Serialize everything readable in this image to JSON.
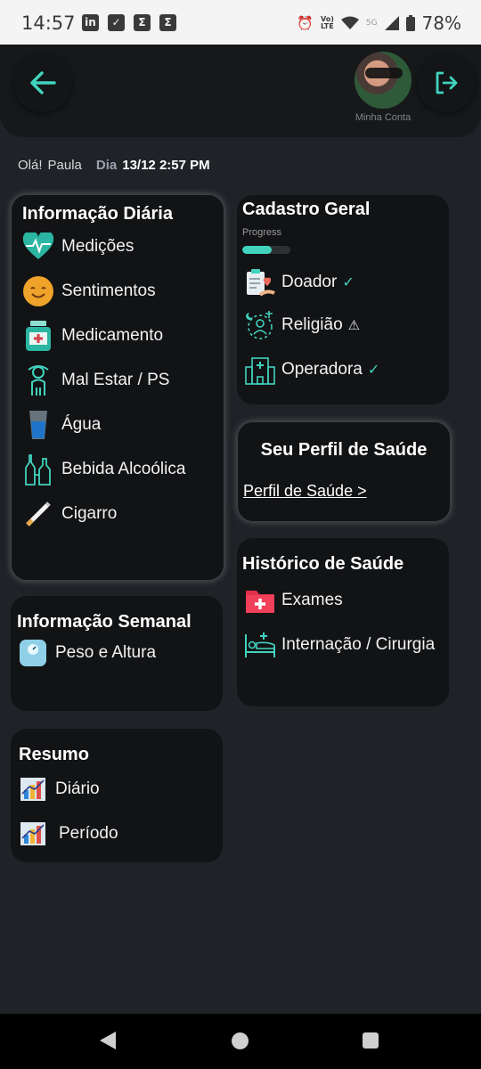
{
  "status_bar": {
    "time": "14:57",
    "apps": [
      "in",
      "✓",
      "Σ",
      "Σ"
    ],
    "net_top": "Vo)",
    "net_bottom": "LTE",
    "signal_label": "5G",
    "battery": "78%"
  },
  "header": {
    "back_icon": "arrow-left-icon",
    "logout_icon": "logout-icon",
    "account_label": "Minha Conta"
  },
  "greeting": {
    "hello": "Olá!",
    "name": "Paula",
    "dia_label": "Dia",
    "datetime": "13/12 2:57 PM"
  },
  "daily": {
    "title": "Informação Diária",
    "items": [
      {
        "label": "Medições",
        "icon": "heart-pulse-icon"
      },
      {
        "label": "Sentimentos",
        "icon": "smiley-icon"
      },
      {
        "label": "Medicamento",
        "icon": "medicine-icon"
      },
      {
        "label": "Mal Estar  / PS",
        "icon": "sick-person-icon"
      },
      {
        "label": "Água",
        "icon": "water-glass-icon"
      },
      {
        "label": "Bebida Alcoólica",
        "icon": "bottles-icon"
      },
      {
        "label": "Cigarro",
        "icon": "cigarette-icon"
      }
    ]
  },
  "weekly": {
    "title": "Informação Semanal",
    "items": [
      {
        "label": "Peso e Altura",
        "icon": "scale-icon"
      }
    ]
  },
  "summary": {
    "title": "Resumo",
    "items": [
      {
        "label": "Diário",
        "icon": "bar-chart-icon"
      },
      {
        "label": "Período",
        "icon": "bar-chart-icon"
      }
    ]
  },
  "registry": {
    "title": "Cadastro Geral",
    "progress_label": "Progress",
    "progress_value": 0.62,
    "items": [
      {
        "label": "Doador",
        "icon": "donor-icon",
        "status": "✓"
      },
      {
        "label": "Religião",
        "icon": "religion-icon",
        "status": "⚠"
      },
      {
        "label": "Operadora",
        "icon": "hospital-building-icon",
        "status": "✓"
      }
    ]
  },
  "profile": {
    "title": "Seu Perfil de Saúde",
    "link": "Perfil de Saúde  >"
  },
  "history": {
    "title": "Histórico de Saúde",
    "items": [
      {
        "label": "Exames",
        "icon": "medical-folder-icon"
      },
      {
        "label": "Internação / Cirurgia",
        "icon": "hospital-bed-icon"
      }
    ]
  },
  "colors": {
    "accent": "#41d3be",
    "background": "#1f2327",
    "card": "#121315"
  }
}
